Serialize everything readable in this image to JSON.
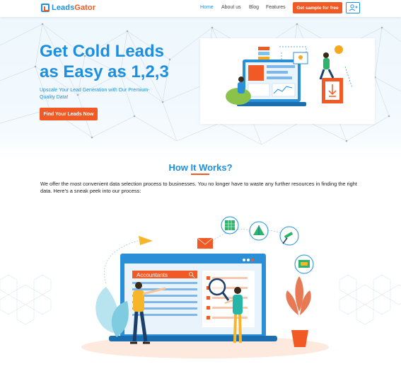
{
  "nav": {
    "brand_part1": "Leads",
    "brand_part2": "Gator",
    "links": [
      "Home",
      "About us",
      "Blog",
      "Features"
    ],
    "cta": "Get sample for free",
    "user_icon": "add-user-icon",
    "accent": "#1d8fe0",
    "brand_orange": "#f15a24"
  },
  "hero": {
    "title_line1": "Get Cold Leads",
    "title_line2": "as Easy as 1,2,3",
    "subtitle": "Upscale Your Lead Generation with Our Premium-Quality Data!",
    "button": "Find Your Leads Now"
  },
  "how": {
    "title": "How It Works?",
    "description": "We offer the most convenient data selection process to businesses. You no longer have to waste any further resources in finding the right data. Here’s a sneak peek into our process:",
    "search_label": "Accountants"
  }
}
